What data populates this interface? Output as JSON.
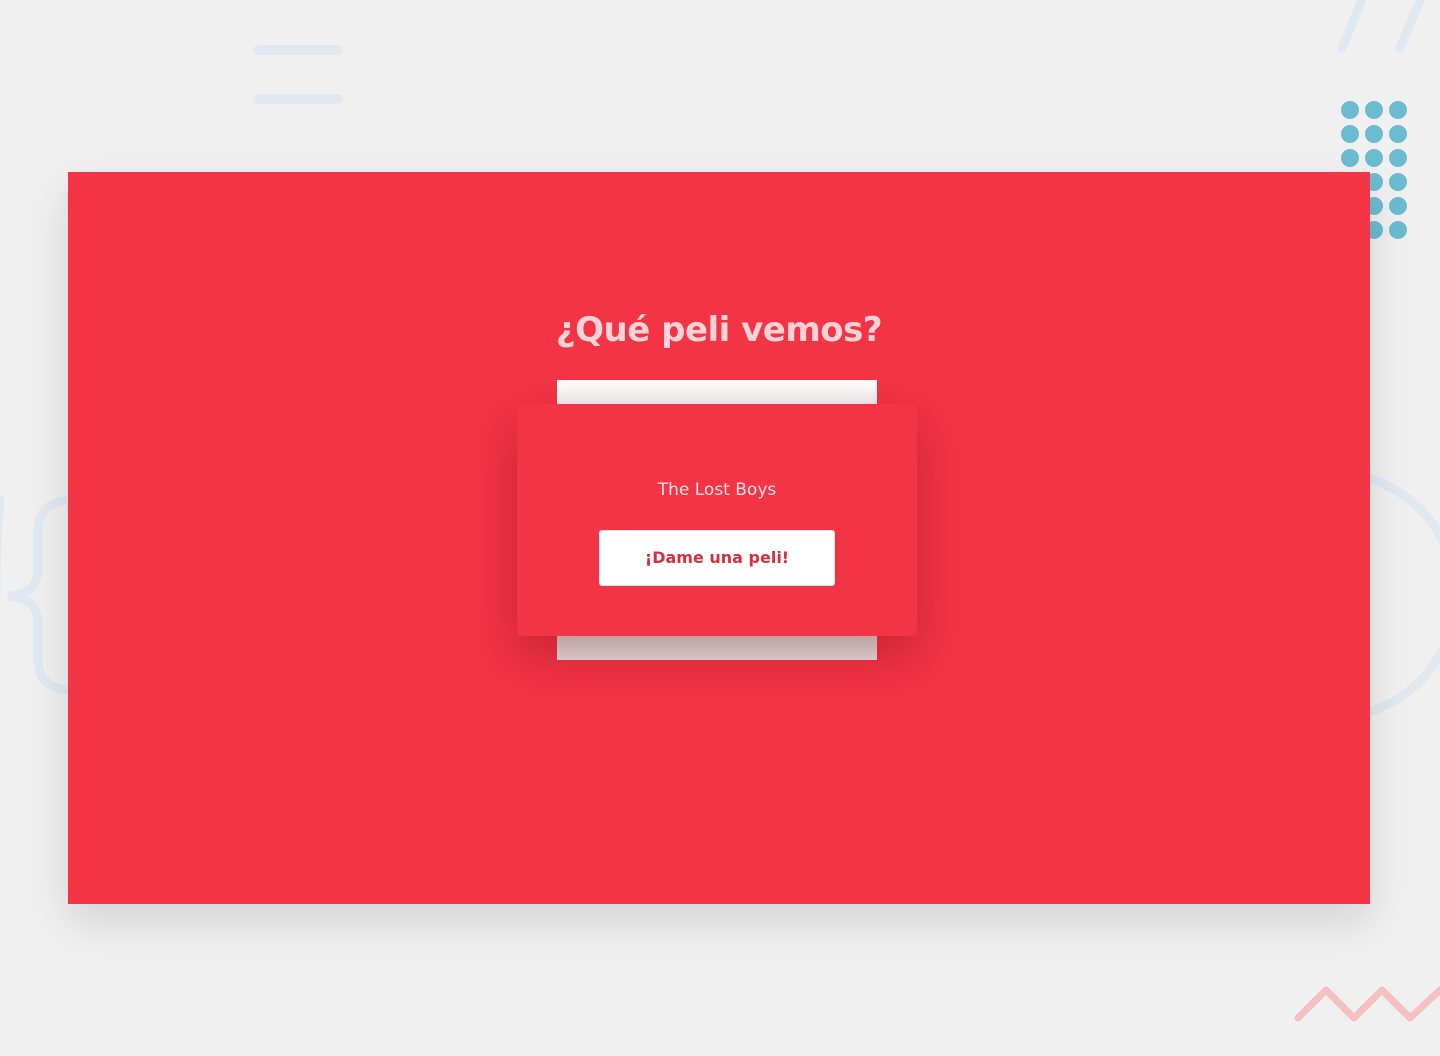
{
  "heading": "¿Qué peli vemos?",
  "movie": {
    "title": "The Lost Boys"
  },
  "button": {
    "label": "¡Dame una peli!"
  },
  "colors": {
    "background": "#f0f0f0",
    "panel": "#f33445",
    "heading": "#fbd3d6",
    "button_text": "#d6303f",
    "dots": "#6bbcd0",
    "zigzag": "#f5c0c0",
    "deco_lines": "#e0e9f2"
  }
}
